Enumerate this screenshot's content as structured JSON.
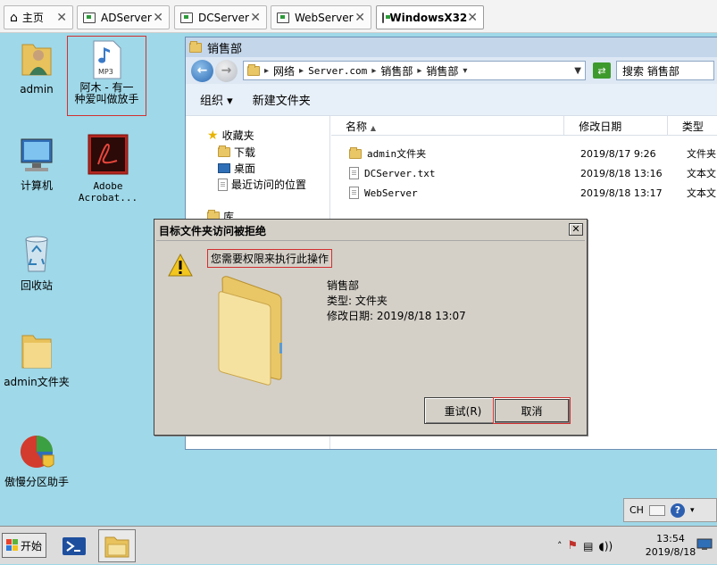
{
  "vm_tabs": [
    {
      "label": "主页"
    },
    {
      "label": "ADServer"
    },
    {
      "label": "DCServer"
    },
    {
      "label": "WebServer"
    },
    {
      "label": "WindowsX32"
    }
  ],
  "desktop_icons": [
    {
      "label": "admin"
    },
    {
      "label_line1": "阿木 - 有一",
      "label_line2": "种爱叫做放手",
      "badge": "MP3"
    },
    {
      "label": "计算机"
    },
    {
      "label_line1": "Adobe",
      "label_line2": "Acrobat..."
    },
    {
      "label": "回收站"
    },
    {
      "label": "admin文件夹"
    },
    {
      "label": "傲慢分区助手"
    }
  ],
  "explorer": {
    "title": "销售部",
    "address": [
      "网络",
      "Server.com",
      "销售部",
      "销售部"
    ],
    "search_placeholder": "搜索 销售部",
    "toolbar": {
      "organize": "组织",
      "new_folder": "新建文件夹"
    },
    "nav": {
      "favorites": "收藏夹",
      "downloads": "下载",
      "desktop": "桌面",
      "recent": "最近访问的位置",
      "libraries": "库"
    },
    "columns": {
      "name": "名称",
      "date": "修改日期",
      "type": "类型"
    },
    "files": [
      {
        "name": "admin文件夹",
        "date": "2019/8/17 9:26",
        "type": "文件夹"
      },
      {
        "name": "DCServer.txt",
        "date": "2019/8/18 13:16",
        "type": "文本文"
      },
      {
        "name": "WebServer",
        "date": "2019/8/18 13:17",
        "type": "文本文"
      }
    ]
  },
  "dialog": {
    "title": "目标文件夹访问被拒绝",
    "message": "您需要权限来执行此操作",
    "item_name": "销售部",
    "item_type": "类型: 文件夹",
    "item_modified": "修改日期: 2019/8/18 13:07",
    "retry": "重试(R)",
    "cancel": "取消"
  },
  "langbar": {
    "lang": "CH",
    "help": "?"
  },
  "taskbar": {
    "start": "开始",
    "time": "13:54",
    "date": "2019/8/18"
  },
  "colors": {
    "desktop": "#9fd8e8",
    "dialog_bg": "#d4d0c8",
    "highlight_box": "#d23030"
  }
}
